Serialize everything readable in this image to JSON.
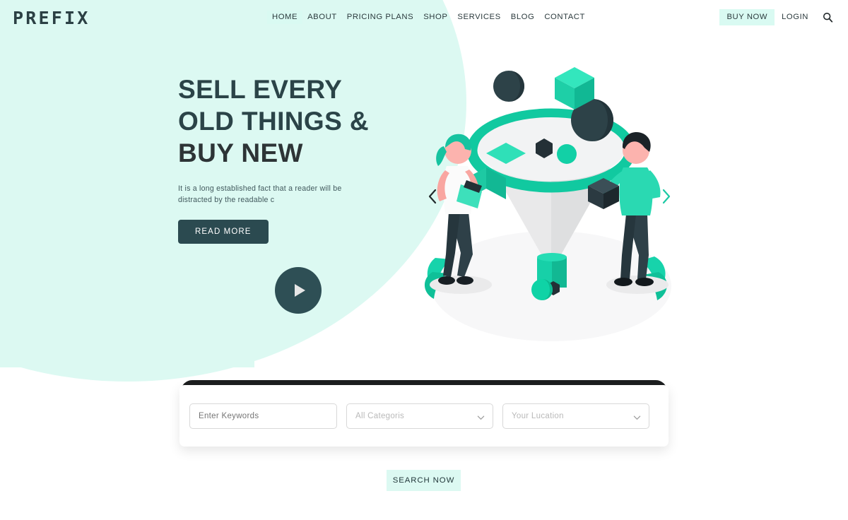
{
  "header": {
    "logo": "PREFIX",
    "nav": [
      {
        "label": "HOME",
        "active": true
      },
      {
        "label": "ABOUT",
        "active": false
      },
      {
        "label": "PRICING PLANS",
        "active": false
      },
      {
        "label": "SHOP",
        "active": false
      },
      {
        "label": "SERVICES",
        "active": false
      },
      {
        "label": "BLOG",
        "active": false
      },
      {
        "label": "CONTACT",
        "active": false
      }
    ],
    "buy_now": "BUY NOW",
    "login": "LOGIN",
    "search_icon": "search-icon"
  },
  "hero": {
    "title_line1": "SELL EVERY",
    "title_line2": "OLD THINGS &",
    "title_line3": "BUY NEW",
    "subtitle": "It is a long established fact that a reader will be distracted by the readable c",
    "cta": "READ MORE",
    "play_icon": "play-icon",
    "prev_icon": "chevron-left-icon",
    "next_icon": "chevron-right-icon"
  },
  "search": {
    "keywords_placeholder": "Enter Keywords",
    "category_value": "All Categoris",
    "location_value": "Your Lucation",
    "submit_label": "SEARCH NOW",
    "chevron_icon": "chevron-down-icon"
  },
  "colors": {
    "mint_bg": "#dcf9f2",
    "teal_accent": "#1cc9a4",
    "dark_teal": "#2b4a50",
    "dark_ink": "#2d3436",
    "card_dark": "#1d1f20"
  }
}
